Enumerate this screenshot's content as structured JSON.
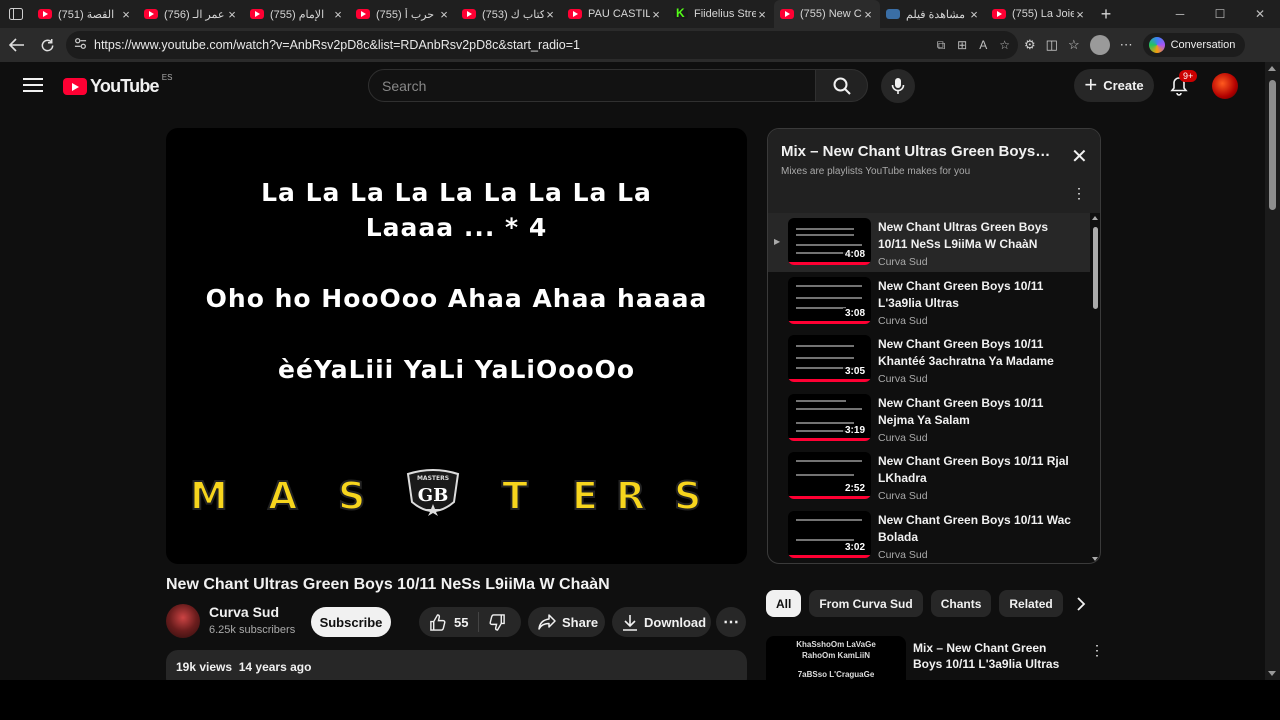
{
  "browser": {
    "tabs": [
      {
        "label": "(751) القصة",
        "fav": "yt"
      },
      {
        "label": "(756) عمر الـ",
        "fav": "yt"
      },
      {
        "label": "(755) الإمام",
        "fav": "yt"
      },
      {
        "label": "(755) حرب أ",
        "fav": "yt"
      },
      {
        "label": "(753) كتاب ك",
        "fav": "yt"
      },
      {
        "label": "PAU CASTILL",
        "fav": "yt"
      },
      {
        "label": "Fiidelius Stre",
        "fav": "kick"
      },
      {
        "label": "(755) New C",
        "fav": "yt"
      },
      {
        "label": "مشاهدة فيلم",
        "fav": "edge"
      },
      {
        "label": "(755) La Joie",
        "fav": "yt"
      }
    ],
    "url": "https://www.youtube.com/watch?v=AnbRsv2pD8c&list=RDAnbRsv2pD8c&start_radio=1",
    "copilot_label": "Conversation"
  },
  "masthead": {
    "logo_text": "YouTube",
    "country": "ES",
    "search_placeholder": "Search",
    "create_label": "Create",
    "notifications": "9+"
  },
  "video": {
    "lyrics": [
      "La La La La La La La La La",
      "Laaaa ... * 4",
      "Oho ho HooOoo Ahaa Ahaa haaaa",
      "èéYaLiii YaLi YaLiOooOo"
    ],
    "logo_letters": [
      "M",
      "A",
      "S",
      "T",
      "E",
      "R",
      "S"
    ],
    "badge_top": "MASTERS",
    "badge_text": "GB",
    "title": "New Chant Ultras Green Boys 10/11 NeSs L9iiMa W ChaàN",
    "channel": "Curva Sud",
    "subscribers": "6.25k subscribers",
    "subscribe_label": "Subscribe",
    "likes": "55",
    "share_label": "Share",
    "download_label": "Download",
    "views": "19k views",
    "age": "14 years ago"
  },
  "playlist": {
    "title": "Mix – New Chant Ultras Green Boys…",
    "subtitle": "Mixes are playlists YouTube makes for you",
    "items": [
      {
        "title": "New Chant Ultras Green Boys 10/11 NeSs L9iiMa W ChaàN",
        "channel": "Curva Sud",
        "duration": "4:08",
        "current": true
      },
      {
        "title": "New Chant Green Boys 10/11 L'3a9lia Ultras",
        "channel": "Curva Sud",
        "duration": "3:08"
      },
      {
        "title": "New Chant Green Boys 10/11 Khantéé 3achratna Ya Madame",
        "channel": "Curva Sud",
        "duration": "3:05"
      },
      {
        "title": "New Chant Green Boys 10/11 Nejma Ya Salam",
        "channel": "Curva Sud",
        "duration": "3:19"
      },
      {
        "title": "New Chant Green Boys 10/11 Rjal LKhadra",
        "channel": "Curva Sud",
        "duration": "2:52"
      },
      {
        "title": "New Chant Green Boys 10/11 Wac Bolada",
        "channel": "Curva Sud",
        "duration": "3:02"
      }
    ]
  },
  "chips": [
    "All",
    "From Curva Sud",
    "Chants",
    "Related"
  ],
  "recommendation": {
    "title": "Mix – New Chant Green Boys 10/11 L'3a9lia Ultras",
    "thumb_lines": [
      "KhaSshoOm LaVaGe",
      "RahoOm KamLiiN",
      "7aBSso L'CraguaGe"
    ]
  },
  "colors": {
    "accent": "#ff0033",
    "background": "#0f0f0f",
    "logo_yellow": "#f7d51d"
  }
}
